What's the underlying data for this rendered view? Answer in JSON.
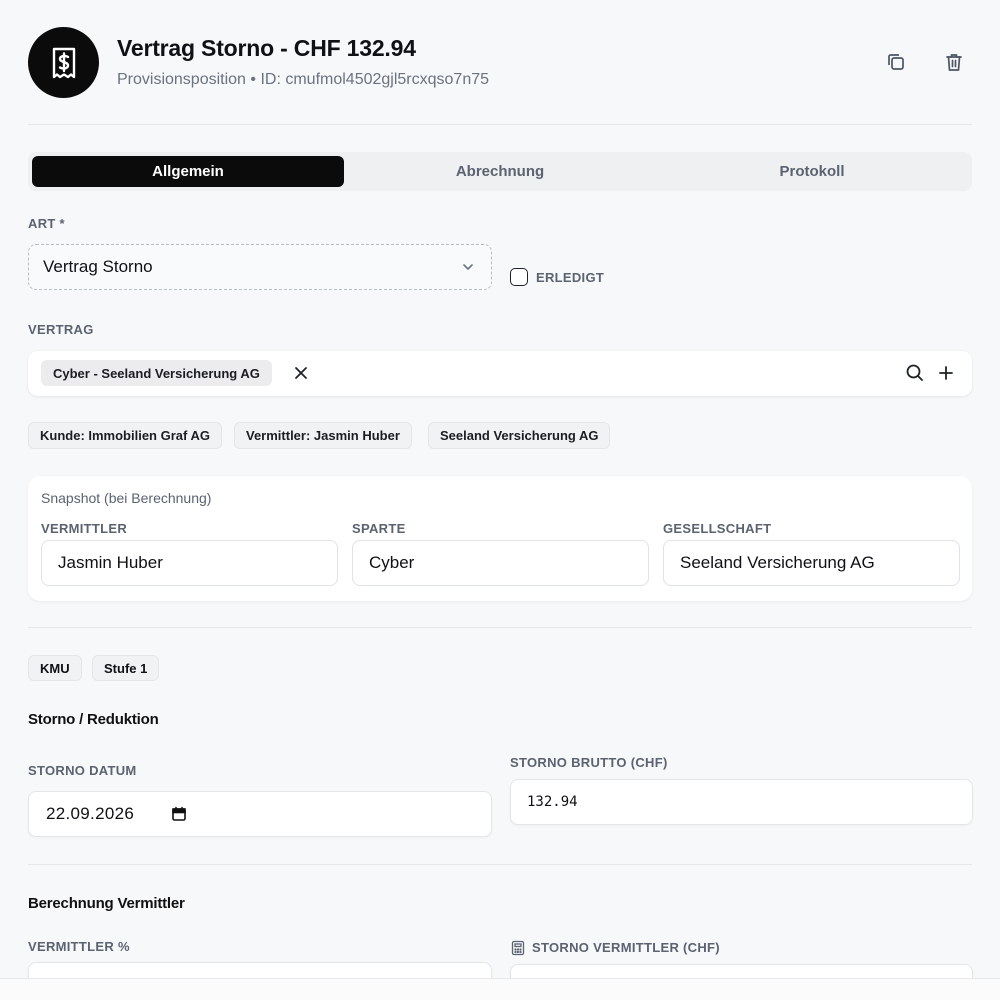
{
  "header": {
    "title": "Vertrag Storno - CHF 132.94",
    "subtitle": "Provisionsposition • ID: cmufmol4502gjl5rcxqso7n75",
    "avatar_icon": "receipt-dollar-icon",
    "actions": {
      "copy_icon": "copy-icon",
      "delete_icon": "trash-icon"
    }
  },
  "tabs": [
    {
      "label": "Allgemein",
      "active": true
    },
    {
      "label": "Abrechnung",
      "active": false
    },
    {
      "label": "Protokoll",
      "active": false
    }
  ],
  "art": {
    "label": "ART *",
    "value": "Vertrag Storno"
  },
  "erledigt": {
    "label": "ERLEDIGT",
    "checked": false
  },
  "vertrag": {
    "label": "VERTRAG",
    "selected_chip": "Cyber - Seeland Versicherung AG",
    "meta": [
      "Kunde: Immobilien Graf AG",
      "Vermittler: Jasmin Huber",
      "Seeland Versicherung AG"
    ]
  },
  "snapshot": {
    "title": "Snapshot (bei Berechnung)",
    "fields": [
      {
        "label": "VERMITTLER",
        "value": "Jasmin Huber"
      },
      {
        "label": "SPARTE",
        "value": "Cyber"
      },
      {
        "label": "GESELLSCHAFT",
        "value": "Seeland Versicherung AG"
      }
    ]
  },
  "tags": [
    "KMU",
    "Stufe 1"
  ],
  "storno": {
    "title": "Storno / Reduktion",
    "datum_label": "STORNO DATUM",
    "datum_value": "22.09.2026",
    "brutto_label": "STORNO BRUTTO (CHF)",
    "brutto_value": "132.94"
  },
  "berechnung": {
    "title": "Berechnung Vermittler",
    "prozent_label": "VERMITTLER %",
    "storno_vermittler_label": "STORNO VERMITTLER (CHF)"
  },
  "colors": {
    "accent": "#0b0b0c",
    "muted": "#5b6270",
    "background": "#f7f8f9"
  }
}
